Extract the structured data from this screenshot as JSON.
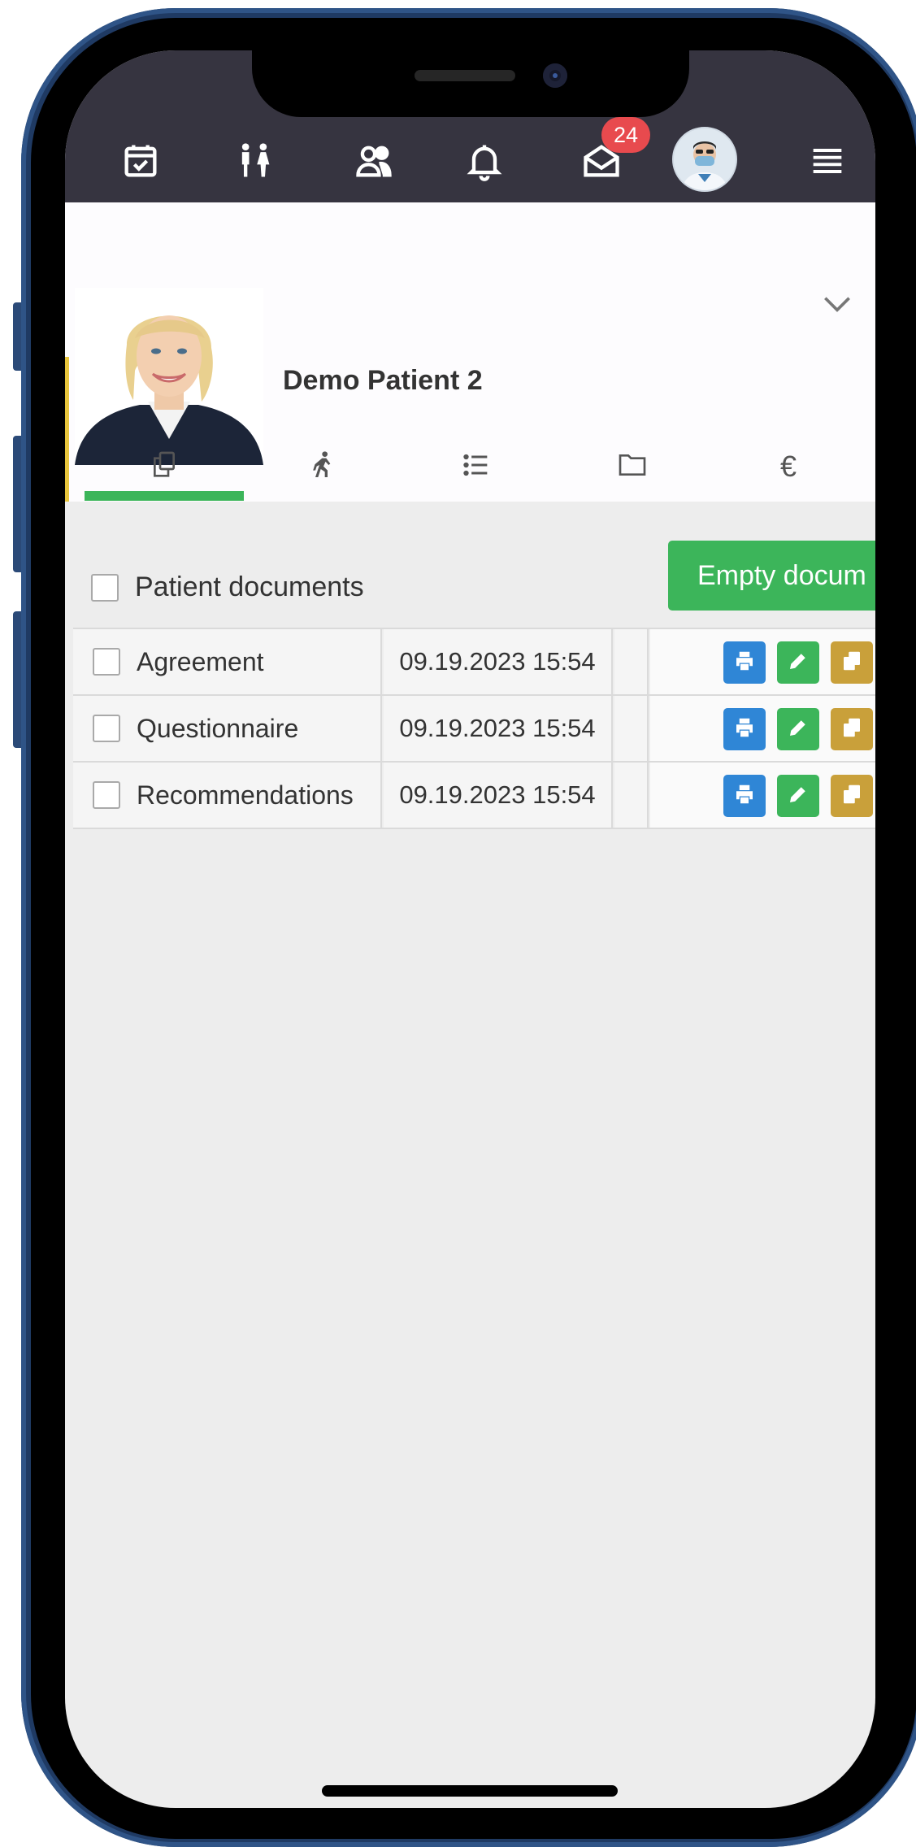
{
  "topbar": {
    "icons": [
      "calendar-check-icon",
      "couple-icon",
      "users-icon",
      "bell-icon",
      "envelope-open-icon",
      "doctor-avatar",
      "hamburger-menu-icon"
    ],
    "mail_badge": "24"
  },
  "patient": {
    "name": "Demo Patient 2"
  },
  "tabs": {
    "items": [
      "documents-icon",
      "walking-person-icon",
      "list-icon",
      "folder-icon",
      "euro-icon"
    ],
    "active_index": 0,
    "euro_symbol": "€"
  },
  "documents": {
    "header_label": "Patient documents",
    "empty_button_label": "Empty docum",
    "rows": [
      {
        "name": "Agreement",
        "date": "09.19.2023 15:54"
      },
      {
        "name": "Questionnaire",
        "date": "09.19.2023 15:54"
      },
      {
        "name": "Recommendations",
        "date": "09.19.2023 15:54"
      }
    ]
  },
  "colors": {
    "topbar_bg": "#363440",
    "accent_green": "#3cb55a",
    "badge_red": "#e84a4e",
    "print_blue": "#2f86d6",
    "edit_green": "#3cb55a",
    "copy_gold": "#c9a03a"
  }
}
